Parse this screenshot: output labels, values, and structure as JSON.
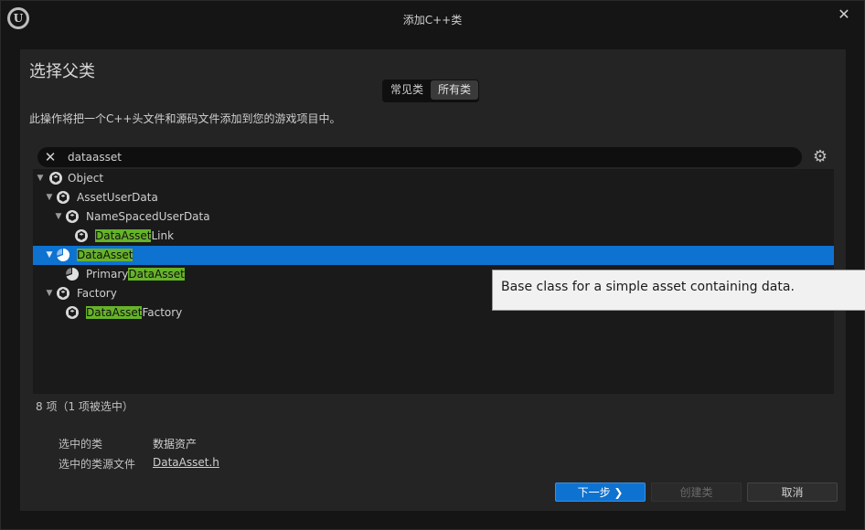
{
  "window": {
    "title": "添加C++类",
    "logo_text": "U",
    "close_icon": "✕"
  },
  "dialog": {
    "heading": "选择父类",
    "description": "此操作将把一个C++头文件和源码文件添加到您的游戏项目中。",
    "tabs": [
      {
        "label": "常见类",
        "active": false
      },
      {
        "label": "所有类",
        "active": true
      }
    ]
  },
  "search": {
    "value": "dataasset",
    "clear_icon": "✕",
    "settings_icon": "⚙"
  },
  "tree": {
    "rows": [
      {
        "prefix": "",
        "match": "",
        "suffix": "Object",
        "expanded": true,
        "icon": "class-icon"
      },
      {
        "prefix": "",
        "match": "",
        "suffix": "AssetUserData",
        "expanded": true,
        "icon": "class-icon"
      },
      {
        "prefix": "",
        "match": "",
        "suffix": "NameSpacedUserData",
        "expanded": true,
        "icon": "class-icon"
      },
      {
        "prefix": "",
        "match": "DataAsset",
        "suffix": "Link",
        "expanded": null,
        "icon": "class-icon"
      },
      {
        "prefix": "",
        "match": "DataAsset",
        "suffix": "",
        "expanded": true,
        "icon": "pie-chart-icon",
        "selected": true
      },
      {
        "prefix": "Primary",
        "match": "DataAsset",
        "suffix": "",
        "expanded": null,
        "icon": "pie-chart-icon"
      },
      {
        "prefix": "",
        "match": "",
        "suffix": "Factory",
        "expanded": true,
        "icon": "class-icon"
      },
      {
        "prefix": "",
        "match": "DataAsset",
        "suffix": "Factory",
        "expanded": null,
        "icon": "class-icon"
      }
    ]
  },
  "status": {
    "count": "8 项（1 项被选中）"
  },
  "selection": {
    "class_label": "选中的类",
    "class_value": "数据资产",
    "file_label": "选中的类源文件",
    "file_value": "DataAsset.h"
  },
  "buttons": {
    "next": "下一步 ❯",
    "create": "创建类",
    "cancel": "取消"
  },
  "tooltip": {
    "text": "Base class for a simple asset containing data."
  },
  "colors": {
    "selection": "#0e72d1",
    "highlight": "#66b329",
    "background": "#151515",
    "panel": "#242424"
  }
}
